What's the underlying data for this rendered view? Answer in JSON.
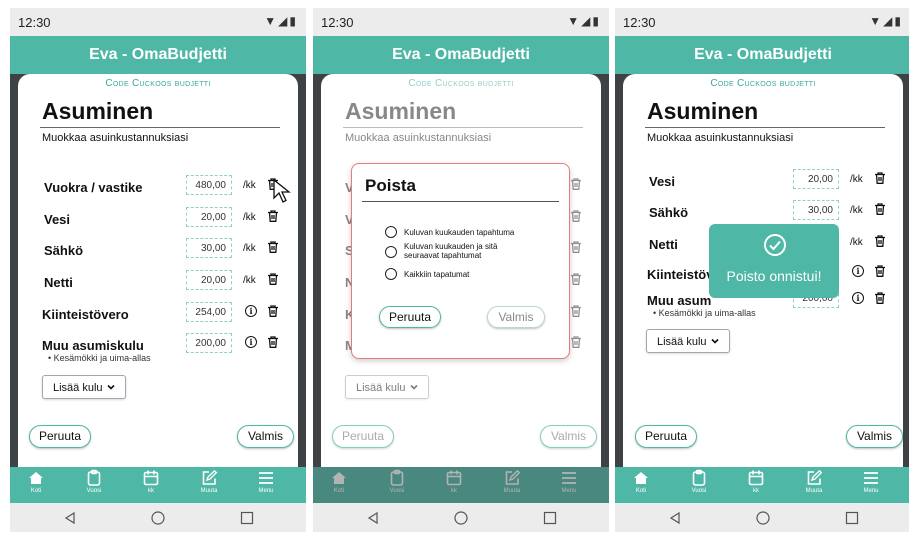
{
  "status": {
    "time": "12:30"
  },
  "app": {
    "title": "Eva - OmaBudjetti",
    "subtitle": "Code Cuckoos budjetti"
  },
  "page": {
    "title": "Asuminen",
    "description": "Muokkaa asuinkustannuksiasi"
  },
  "unit": "/kk",
  "screen1": {
    "items": [
      {
        "label": "Vuokra / vastike",
        "amount": "480,00"
      },
      {
        "label": "Vesi",
        "amount": "20,00"
      },
      {
        "label": "Sähkö",
        "amount": "30,00"
      },
      {
        "label": "Netti",
        "amount": "20,00"
      },
      {
        "label": "Kiinteistövero",
        "amount": "254,00"
      },
      {
        "label": "Muu asumiskulu",
        "amount": "200,00",
        "note": "• Kesämökki ja uima-allas"
      }
    ]
  },
  "screen2": {
    "bg_labels": [
      "V",
      "V",
      "S",
      "N",
      "K",
      "M"
    ],
    "dialog": {
      "title": "Poista",
      "options": [
        "Kuluvan kuukauden tapahtuma",
        "Kuluvan kuukauden ja sitä seuraavat tapahtumat",
        "Kaikkiin tapatumat"
      ],
      "cancel": "Peruuta",
      "confirm": "Valmis"
    }
  },
  "screen3": {
    "items": [
      {
        "label": "Vesi",
        "amount": "20,00"
      },
      {
        "label": "Sähkö",
        "amount": "30,00"
      },
      {
        "label": "Netti",
        "amount": ""
      },
      {
        "label": "Kiinteistöv",
        "amount": ""
      },
      {
        "label": "Muu asum",
        "amount": "200,00",
        "note": "• Kesämökki ja uima-allas"
      }
    ],
    "toast": "Poisto onnistui!"
  },
  "buttons": {
    "add_expense": "Lisää kulu",
    "cancel": "Peruuta",
    "done": "Valmis"
  },
  "nav": [
    "Koti",
    "Vuosi",
    "kk",
    "Muuta",
    "Menu"
  ],
  "colors": {
    "accent": "#4fb7a6",
    "dialog_border": "#e37d7d",
    "frame": "#3e4244"
  }
}
